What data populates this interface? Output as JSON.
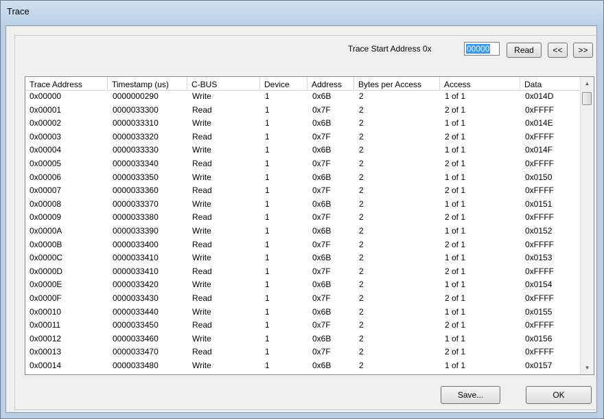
{
  "window": {
    "title": "Trace"
  },
  "controls": {
    "start_label": "Trace Start Address 0x",
    "start_value": "00000",
    "read_label": "Read",
    "prev_label": "<<",
    "next_label": ">>",
    "save_label": "Save...",
    "ok_label": "OK"
  },
  "table": {
    "columns": [
      "Trace Address",
      "Timestamp (us)",
      "C-BUS",
      "Device",
      "Address",
      "Bytes per Access",
      "Access",
      "Data"
    ],
    "rows": [
      [
        "0x00000",
        "0000000290",
        "Write",
        "1",
        "0x6B",
        "2",
        "1 of 1",
        "0x014D"
      ],
      [
        "0x00001",
        "0000033300",
        "Read",
        "1",
        "0x7F",
        "2",
        "2 of 1",
        "0xFFFF"
      ],
      [
        "0x00002",
        "0000033310",
        "Write",
        "1",
        "0x6B",
        "2",
        "1 of 1",
        "0x014E"
      ],
      [
        "0x00003",
        "0000033320",
        "Read",
        "1",
        "0x7F",
        "2",
        "2 of 1",
        "0xFFFF"
      ],
      [
        "0x00004",
        "0000033330",
        "Write",
        "1",
        "0x6B",
        "2",
        "1 of 1",
        "0x014F"
      ],
      [
        "0x00005",
        "0000033340",
        "Read",
        "1",
        "0x7F",
        "2",
        "2 of 1",
        "0xFFFF"
      ],
      [
        "0x00006",
        "0000033350",
        "Write",
        "1",
        "0x6B",
        "2",
        "1 of 1",
        "0x0150"
      ],
      [
        "0x00007",
        "0000033360",
        "Read",
        "1",
        "0x7F",
        "2",
        "2 of 1",
        "0xFFFF"
      ],
      [
        "0x00008",
        "0000033370",
        "Write",
        "1",
        "0x6B",
        "2",
        "1 of 1",
        "0x0151"
      ],
      [
        "0x00009",
        "0000033380",
        "Read",
        "1",
        "0x7F",
        "2",
        "2 of 1",
        "0xFFFF"
      ],
      [
        "0x0000A",
        "0000033390",
        "Write",
        "1",
        "0x6B",
        "2",
        "1 of 1",
        "0x0152"
      ],
      [
        "0x0000B",
        "0000033400",
        "Read",
        "1",
        "0x7F",
        "2",
        "2 of 1",
        "0xFFFF"
      ],
      [
        "0x0000C",
        "0000033410",
        "Write",
        "1",
        "0x6B",
        "2",
        "1 of 1",
        "0x0153"
      ],
      [
        "0x0000D",
        "0000033410",
        "Read",
        "1",
        "0x7F",
        "2",
        "2 of 1",
        "0xFFFF"
      ],
      [
        "0x0000E",
        "0000033420",
        "Write",
        "1",
        "0x6B",
        "2",
        "1 of 1",
        "0x0154"
      ],
      [
        "0x0000F",
        "0000033430",
        "Read",
        "1",
        "0x7F",
        "2",
        "2 of 1",
        "0xFFFF"
      ],
      [
        "0x00010",
        "0000033440",
        "Write",
        "1",
        "0x6B",
        "2",
        "1 of 1",
        "0x0155"
      ],
      [
        "0x00011",
        "0000033450",
        "Read",
        "1",
        "0x7F",
        "2",
        "2 of 1",
        "0xFFFF"
      ],
      [
        "0x00012",
        "0000033460",
        "Write",
        "1",
        "0x6B",
        "2",
        "1 of 1",
        "0x0156"
      ],
      [
        "0x00013",
        "0000033470",
        "Read",
        "1",
        "0x7F",
        "2",
        "2 of 1",
        "0xFFFF"
      ],
      [
        "0x00014",
        "0000033480",
        "Write",
        "1",
        "0x6B",
        "2",
        "1 of 1",
        "0x0157"
      ]
    ]
  },
  "icons": {
    "scroll_up": "scroll-up-arrow-icon",
    "scroll_down": "scroll-down-arrow-icon"
  }
}
